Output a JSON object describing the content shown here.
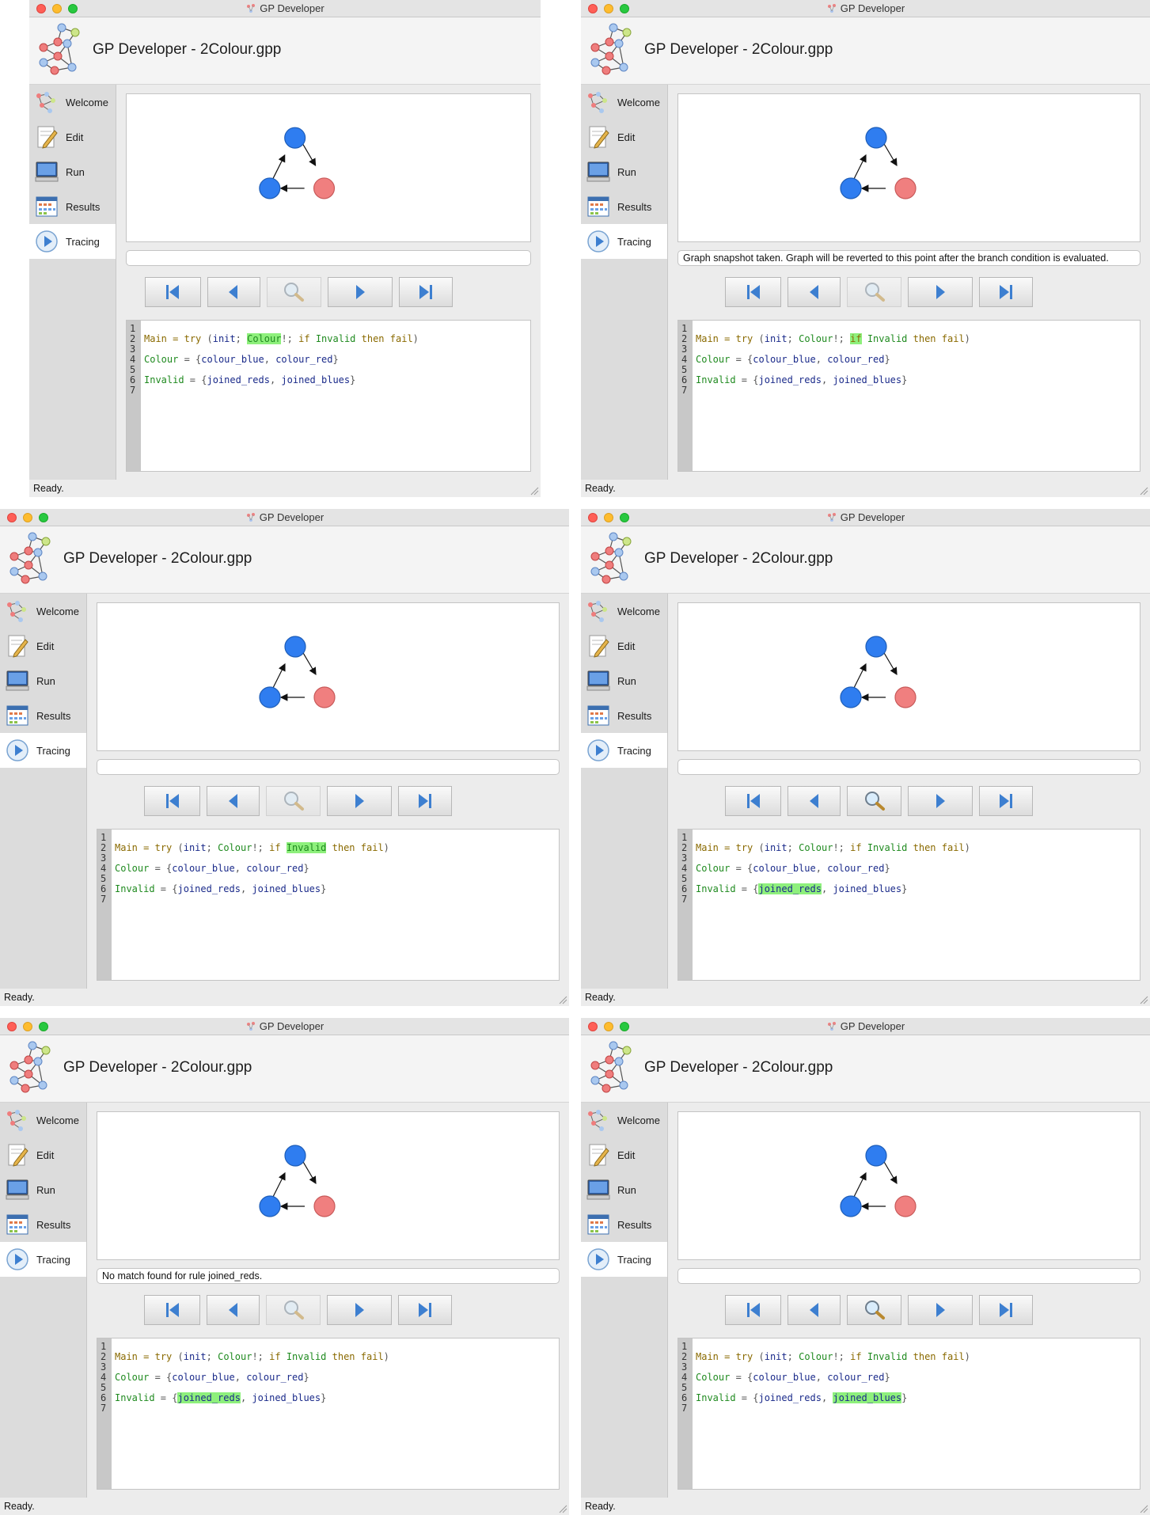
{
  "window_title": "GP Developer",
  "app_title": "GP Developer - 2Colour.gpp",
  "status_text": "Ready.",
  "sidebar_items": [
    {
      "label": "Welcome",
      "icon": "welcome-graph-icon"
    },
    {
      "label": "Edit",
      "icon": "edit-pencil-icon"
    },
    {
      "label": "Run",
      "icon": "run-computer-icon"
    },
    {
      "label": "Results",
      "icon": "results-calendar-icon"
    },
    {
      "label": "Tracing",
      "icon": "tracing-play-icon"
    }
  ],
  "active_sidebar_item": "Tracing",
  "trace_buttons": [
    {
      "name": "jump-to-start-button",
      "icon": "skip-to-start-icon"
    },
    {
      "name": "step-back-button",
      "icon": "step-back-icon"
    },
    {
      "name": "find-match-button",
      "icon": "magnifier-icon"
    },
    {
      "name": "step-forward-button",
      "icon": "step-forward-icon"
    },
    {
      "name": "jump-to-end-button",
      "icon": "skip-to-end-icon"
    }
  ],
  "line_numbers": [
    "1",
    "2",
    "3",
    "4",
    "5",
    "6",
    "7"
  ],
  "graph": {
    "nodes": [
      {
        "id": "top",
        "color": "#2f7df0"
      },
      {
        "id": "bottom-left",
        "color": "#2f7df0"
      },
      {
        "id": "bottom-right",
        "color": "#f07f7f"
      }
    ],
    "edges": [
      [
        "bottom-left",
        "top"
      ],
      [
        "top",
        "bottom-right"
      ],
      [
        "bottom-right",
        "bottom-left"
      ]
    ]
  },
  "colors": {
    "highlight": "#8ef07c",
    "keyword": "#8a6a00",
    "rule_name": "#1a2a8a",
    "identifier": "#1f8a1f"
  },
  "panels": [
    {
      "message": "",
      "find_enabled": false,
      "highlight": "colour_call"
    },
    {
      "message": "Graph snapshot taken. Graph will be reverted to this point after the branch condition is evaluated.",
      "find_enabled": false,
      "highlight": "if_keyword"
    },
    {
      "message": "",
      "find_enabled": false,
      "highlight": "invalid_call"
    },
    {
      "message": "",
      "find_enabled": true,
      "highlight": "joined_reds"
    },
    {
      "message": "No match found for rule joined_reds.",
      "find_enabled": false,
      "highlight": "joined_reds"
    },
    {
      "message": "",
      "find_enabled": true,
      "highlight": "joined_blues"
    }
  ],
  "code_tokens": {
    "l2_main": "Main",
    "l2_eq": " = ",
    "l2_try": "try",
    "l2_open": " (",
    "l2_init": "init",
    "l2_semi1": "; ",
    "l2_colour": "Colour",
    "l2_bang": "!; ",
    "l2_if": "if",
    "l2_sp": " ",
    "l2_invalid": "Invalid",
    "l2_then": " then ",
    "l2_fail": "fail",
    "l2_close": ")",
    "l4_colour": "Colour",
    "l4_eq": " = {",
    "l4_blue": "colour_blue",
    "l4_comma": ", ",
    "l4_red": "colour_red",
    "l4_close": "}",
    "l6_invalid": "Invalid",
    "l6_eq": " = {",
    "l6_reds": "joined_reds",
    "l6_comma": ", ",
    "l6_blues": "joined_blues",
    "l6_close": "}"
  }
}
